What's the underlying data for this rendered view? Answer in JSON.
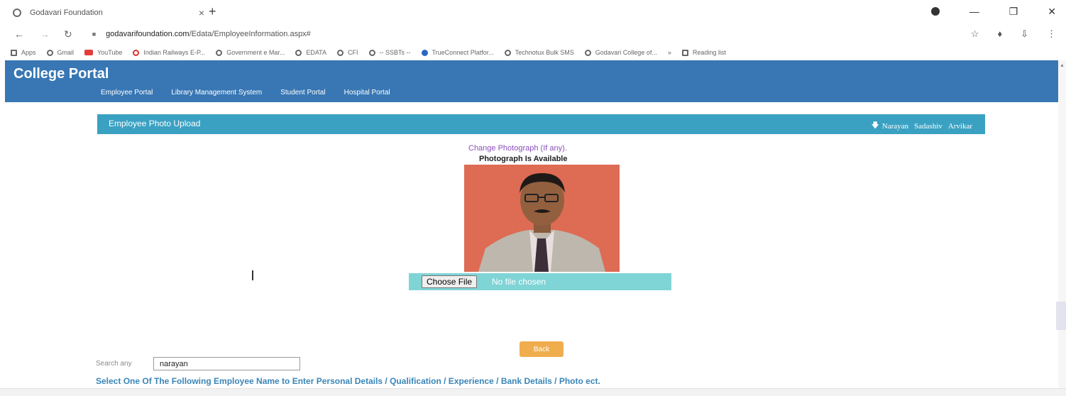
{
  "browser": {
    "tab_title": "Godavari Foundation",
    "tab_close": "×",
    "new_tab": "+",
    "url_domain": "godavarifoundation.com",
    "url_path": "/Edata/EmployeeInformation.aspx#",
    "bookmarks": [
      "Apps",
      "Gmail",
      "YouTube",
      "Indian Railways E-P...",
      "Government e Mar...",
      "EDATA",
      "CFI",
      "-- SSBTs --",
      "TrueConnect Platfor...",
      "Technotux Bulk SMS",
      "Godavari College of...",
      "»",
      "Reading list"
    ]
  },
  "site": {
    "title": "College Portal",
    "nav": [
      "Employee Portal",
      "Library Management System",
      "Student Portal",
      "Hospital Portal"
    ]
  },
  "panel": {
    "title": "Employee Photo Upload",
    "user_first": "Narayan",
    "user_middle": "Sadashiv",
    "user_last": "Arvikar"
  },
  "photo": {
    "change_link": "Change Photograph (If any).",
    "status": "Photograph Is Available",
    "choose_file_label": "Choose File",
    "no_file_text": "No file chosen"
  },
  "actions": {
    "back_label": "Back"
  },
  "search": {
    "label": "Search any",
    "value": "narayan"
  },
  "instruction": "Select One Of The Following Employee Name to Enter Personal Details / Qualification / Experience / Bank Details / Photo ect.",
  "colors": {
    "header": "#3877b4",
    "panel": "#3aa1c2",
    "back_button": "#f0ad4e",
    "file_row": "#7fd4d6"
  }
}
